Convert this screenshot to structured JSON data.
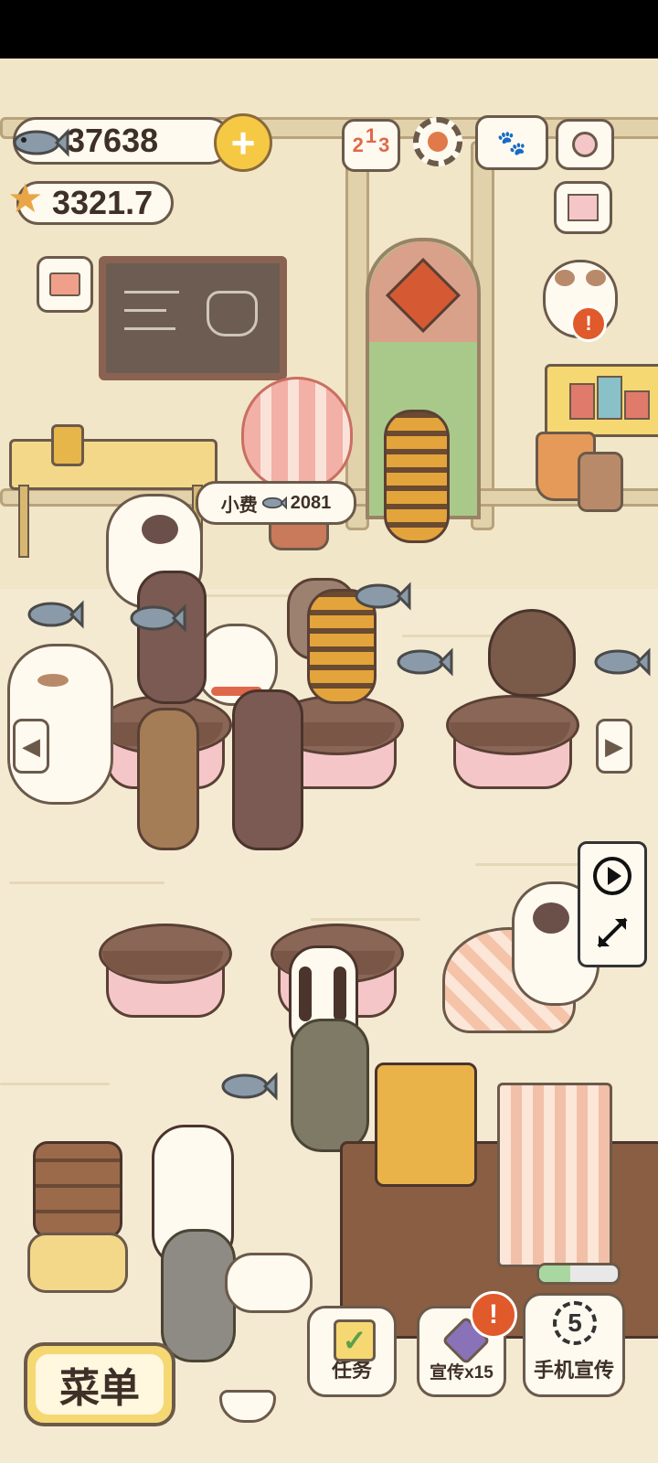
{
  "hud": {
    "fish_count": "37638",
    "star_count": "3321.7"
  },
  "tip_bubble": {
    "label": "小费",
    "amount": "2081"
  },
  "buttons": {
    "menu_label": "菜单",
    "tasks_label": "任务",
    "promote_label": "宣传x15",
    "phone_promote_label": "手机宣传",
    "phone_promote_timer": "5"
  },
  "ranking_icon_digits": [
    "2",
    "1",
    "3"
  ],
  "colors": {
    "alert_badge": "#e05a2b",
    "menu_button": "#f6d873",
    "plus_button": "#f6c945",
    "wood": "#8a6656",
    "table_skirt": "#f5c6c8"
  },
  "icons": [
    "fish-icon",
    "star-icon",
    "plus-icon",
    "ranking-icon",
    "settings-gear-icon",
    "paw-book-icon",
    "camera-icon",
    "newspaper-icon",
    "shop-icon",
    "play-video-icon",
    "expand-icon",
    "checklist-icon",
    "alert-icon",
    "arrow-left-icon",
    "arrow-right-icon",
    "chevron-down-icon"
  ]
}
